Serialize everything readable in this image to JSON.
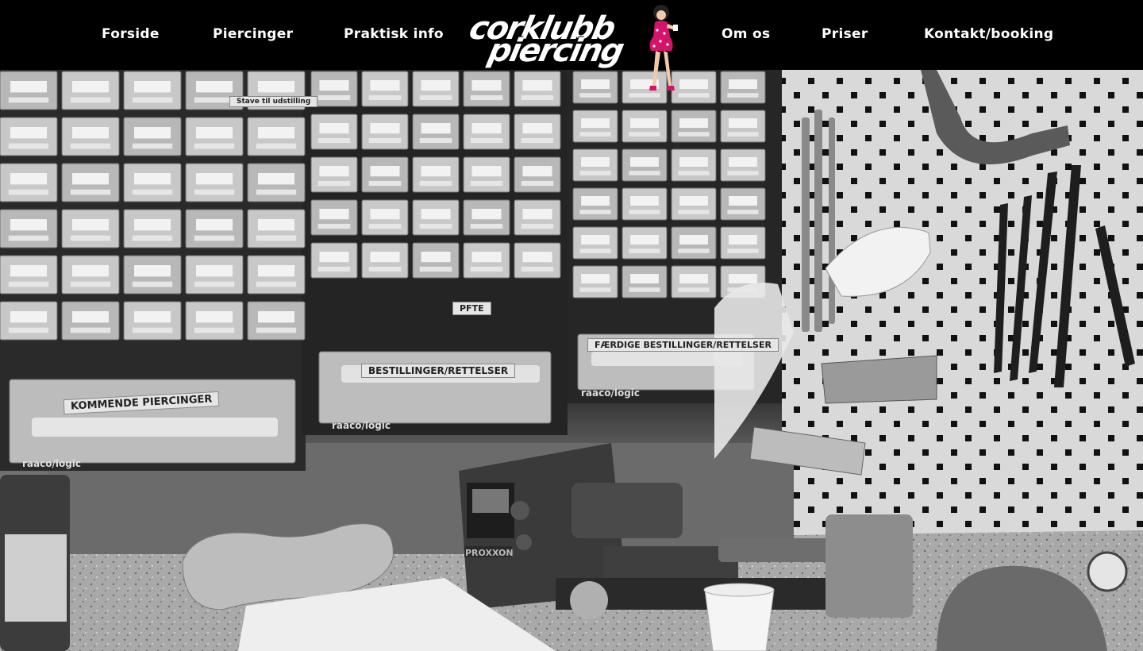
{
  "nav": {
    "left": [
      "Forside",
      "Piercinger",
      "Praktisk info"
    ],
    "right": [
      "Om os",
      "Priser",
      "Kontakt/booking"
    ]
  },
  "logo": {
    "line1": "corklubb",
    "line2": "piercing"
  },
  "hero": {
    "rack_labels": {
      "left_bottom": "KOMMENDE PIERCINGER",
      "middle_bottom": "BESTILLINGER/RETTELSER",
      "right_bottom": "FÆRDIGE BESTILLINGER/RETTELSER",
      "pfte": "PFTE",
      "staar_til_udstilling": "Stave til udstilling",
      "brand": "raaco/logic"
    },
    "machine_label": "PROXXON"
  }
}
